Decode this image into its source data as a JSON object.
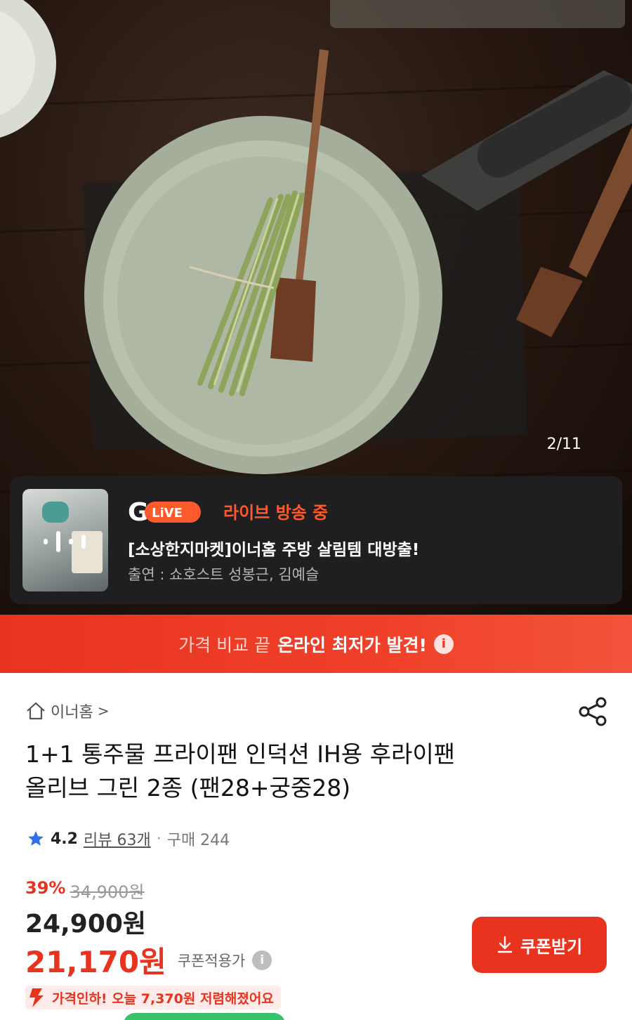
{
  "gallery": {
    "page_indicator": "2/11",
    "image_icon": "frying-pan-product-photo"
  },
  "live": {
    "logo_g": "G",
    "logo_live": "LiVE",
    "status": "라이브 방송 중",
    "title": "[소상한지마켓]이너홈 주방 살림템 대방출!",
    "cast": "출연 : 쇼호스트 성봉근, 김예슬"
  },
  "promo": {
    "light_text": "가격 비교 끝",
    "strong_text": "온라인 최저가 발견!",
    "info_icon": "i"
  },
  "product": {
    "store_name": "이너홈",
    "store_chevron": ">",
    "title_line1": "1+1 통주물 프라이팬 인덕션 IH용 후라이팬",
    "title_line2": "올리브 그린 2종 (팬28+궁중28)",
    "rating": "4.2",
    "reviews": "리뷰 63개",
    "separator": "·",
    "purchases": "구매 244"
  },
  "price": {
    "discount_pct": "39%",
    "original": "34,900원",
    "sale": "24,900원",
    "coupon_price": "21,170원",
    "coupon_label": "쿠폰적용가",
    "coupon_info_icon": "i",
    "coupon_button": "쿠폰받기",
    "price_drop": "가격인하! 오늘 7,370원 저렴해졌어요"
  },
  "colors": {
    "accent": "#e8331f",
    "star": "#2f6fe8",
    "live_orange": "#ff5a2c"
  }
}
